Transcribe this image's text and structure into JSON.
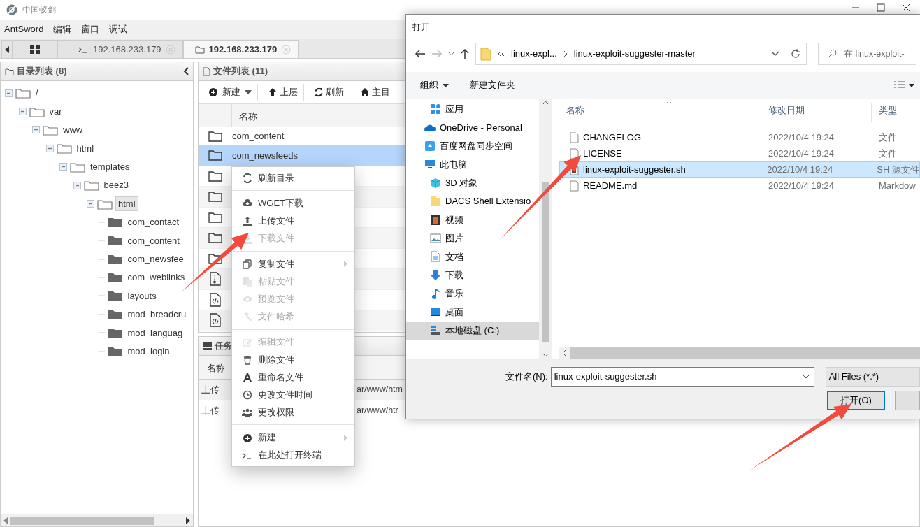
{
  "window": {
    "title": "中国蚁剑"
  },
  "menu_bar": [
    "AntSword",
    "编辑",
    "窗口",
    "调试"
  ],
  "tabs": [
    {
      "kind": "home",
      "selected": false
    },
    {
      "kind": "terminal",
      "label": "192.168.233.179",
      "selected": false
    },
    {
      "kind": "folder",
      "label": "192.168.233.179",
      "selected": true
    }
  ],
  "directory_panel": {
    "title": "目录列表 (8)",
    "tree": [
      {
        "label": "/",
        "expanded": true,
        "selected": false,
        "children": [
          {
            "label": "var",
            "expanded": true,
            "selected": false,
            "children": [
              {
                "label": "www",
                "expanded": true,
                "selected": false,
                "children": [
                  {
                    "label": "html",
                    "expanded": true,
                    "selected": false,
                    "children": [
                      {
                        "label": "templates",
                        "expanded": true,
                        "selected": false,
                        "children": [
                          {
                            "label": "beez3",
                            "expanded": true,
                            "selected": false,
                            "children": [
                              {
                                "label": "html",
                                "expanded": true,
                                "selected": true,
                                "children": [
                                  {
                                    "label": "com_contact",
                                    "selected": false
                                  },
                                  {
                                    "label": "com_content",
                                    "selected": false
                                  },
                                  {
                                    "label": "com_newsfee",
                                    "selected": false
                                  },
                                  {
                                    "label": "com_weblinks",
                                    "selected": false
                                  },
                                  {
                                    "label": "layouts",
                                    "selected": false
                                  },
                                  {
                                    "label": "mod_breadcru",
                                    "selected": false
                                  },
                                  {
                                    "label": "mod_languag",
                                    "selected": false
                                  },
                                  {
                                    "label": "mod_login",
                                    "selected": false
                                  }
                                ]
                              }
                            ]
                          }
                        ]
                      }
                    ]
                  }
                ]
              }
            ]
          }
        ]
      }
    ]
  },
  "file_panel": {
    "title": "文件列表 (11)",
    "toolbar": [
      {
        "kind": "new",
        "label": "新建"
      },
      {
        "kind": "up",
        "label": "上层"
      },
      {
        "kind": "refresh",
        "label": "刷新"
      },
      {
        "kind": "home",
        "label": "主目"
      }
    ],
    "column": "名称",
    "files": [
      {
        "kind": "folder",
        "name": "com_content",
        "selected": false
      },
      {
        "kind": "folder",
        "name": "com_newsfeeds",
        "selected": true
      },
      {
        "kind": "folder",
        "selected": false
      },
      {
        "kind": "folder",
        "selected": false
      },
      {
        "kind": "folder",
        "selected": false
      },
      {
        "kind": "folder",
        "selected": false
      },
      {
        "kind": "folder",
        "selected": false
      },
      {
        "kind": "zip",
        "selected": false
      },
      {
        "kind": "code",
        "selected": false
      },
      {
        "kind": "code",
        "selected": false
      }
    ]
  },
  "task_panel": {
    "title": "任务",
    "column": "名称",
    "rows": [
      {
        "name": "上传",
        "detail": "ar/www/htm"
      },
      {
        "name": "上传",
        "detail": "ar/www/htr"
      }
    ]
  },
  "context_menu": {
    "items": [
      {
        "kind": "item",
        "label": "刷新目录",
        "disabled": false,
        "submenu": false
      },
      {
        "kind": "separator"
      },
      {
        "kind": "item",
        "label": "WGET下载",
        "disabled": false,
        "submenu": false
      },
      {
        "kind": "item",
        "label": "上传文件",
        "disabled": false,
        "submenu": false
      },
      {
        "kind": "item",
        "label": "下载文件",
        "disabled": true,
        "submenu": false
      },
      {
        "kind": "separator"
      },
      {
        "kind": "item",
        "label": "复制文件",
        "disabled": false,
        "submenu": true
      },
      {
        "kind": "item",
        "label": "粘贴文件",
        "disabled": true,
        "submenu": false
      },
      {
        "kind": "item",
        "label": "预览文件",
        "disabled": true,
        "submenu": false
      },
      {
        "kind": "item",
        "label": "文件哈希",
        "disabled": true,
        "submenu": false
      },
      {
        "kind": "separator"
      },
      {
        "kind": "item",
        "label": "编辑文件",
        "disabled": true,
        "submenu": false
      },
      {
        "kind": "item",
        "label": "删除文件",
        "disabled": false,
        "submenu": false
      },
      {
        "kind": "item",
        "label": "重命名文件",
        "disabled": false,
        "submenu": false
      },
      {
        "kind": "item",
        "label": "更改文件时间",
        "disabled": false,
        "submenu": false
      },
      {
        "kind": "item",
        "label": "更改权限",
        "disabled": false,
        "submenu": false
      },
      {
        "kind": "separator"
      },
      {
        "kind": "item",
        "label": "新建",
        "disabled": false,
        "submenu": true
      },
      {
        "kind": "item",
        "label": "在此处打开终端",
        "disabled": false,
        "submenu": false
      }
    ]
  },
  "open_dialog": {
    "title": "打开",
    "path": [
      "linux-expl...",
      "linux-exploit-suggester-master"
    ],
    "search_placeholder": "在 linux-exploit-",
    "toolbar": [
      "组织",
      "新建文件夹"
    ],
    "nav": [
      {
        "children": [
          {
            "label": "应用",
            "selected": false
          }
        ]
      },
      {
        "label": "OneDrive - Personal",
        "selected": false
      },
      {
        "label": "百度网盘同步空间",
        "selected": false
      },
      {
        "label": "此电脑",
        "selected": false,
        "children": [
          {
            "label": "3D 对象",
            "selected": false
          },
          {
            "label": "DACS Shell Extensio",
            "selected": false
          },
          {
            "label": "视频",
            "selected": false
          },
          {
            "label": "图片",
            "selected": false
          },
          {
            "label": "文档",
            "selected": false
          },
          {
            "label": "下载",
            "selected": false
          },
          {
            "label": "音乐",
            "selected": false
          },
          {
            "label": "桌面",
            "selected": false
          },
          {
            "label": "本地磁盘 (C:)",
            "selected": true
          }
        ]
      }
    ],
    "columns": [
      "名称",
      "修改日期",
      "类型"
    ],
    "files": [
      {
        "name": "CHANGELOG",
        "modified": "2022/10/4 19:24",
        "type": "文件",
        "selected": false
      },
      {
        "name": "LICENSE",
        "modified": "2022/10/4 19:24",
        "type": "文件",
        "selected": false
      },
      {
        "name": "linux-exploit-suggester.sh",
        "modified": "2022/10/4 19:24",
        "type": "SH 源文件",
        "selected": true
      },
      {
        "name": "README.md",
        "modified": "2022/10/4 19:24",
        "type": "Markdow",
        "selected": false
      }
    ],
    "filename_label": "文件名(N):",
    "filename": "linux-exploit-suggester.sh",
    "filter": "All Files (*.*)",
    "open_button": "打开(O)"
  }
}
